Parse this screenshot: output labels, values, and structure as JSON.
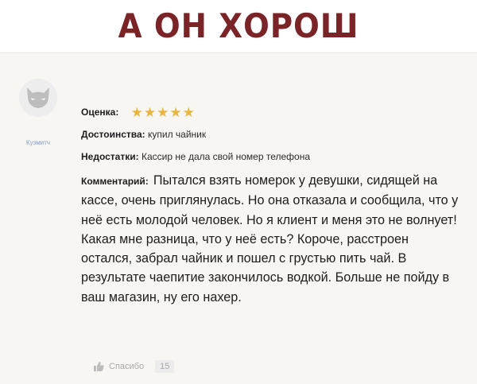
{
  "title": "А ОН ХОРОШ",
  "review": {
    "user": "Кузмитч",
    "rating_label": "Оценка:",
    "rating": 5,
    "rating_max": 5,
    "pros_label": "Достоинства:",
    "pros": "купил чайник",
    "cons_label": "Недостатки:",
    "cons": "Кассир не дала свой номер телефона",
    "comment_label": "Комментарий:",
    "comment": "Пытался взять номерок у девушки, сидящей на кассе, очень приглянулась. Но она отказала и сообщила, что у неё есть молодой человек. Но я клиент и меня это не волнует! Какая мне разница, что у неё есть? Короче, расстроен остался, забрал чайник и пошел с грустью пить чай. В результате чаепитие закончилось водкой. Больше не пойду в ваш магазин, ну его нахер.",
    "thanks_label": "Спасибо",
    "thanks_count": "15"
  },
  "colors": {
    "title": "#7a2428",
    "star": "#e8b63d",
    "username": "#7f9fc4"
  },
  "icons": {
    "avatar": "cat-avatar-icon",
    "star": "star-icon",
    "thanks": "thumbs-up-icon"
  }
}
